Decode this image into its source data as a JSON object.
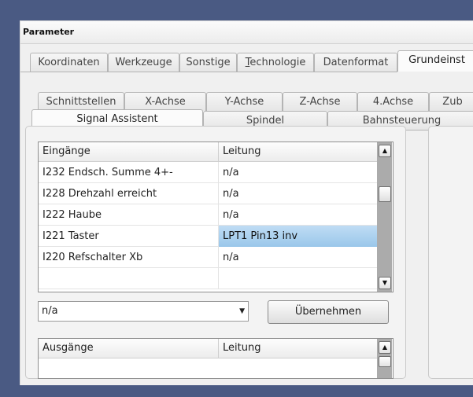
{
  "window": {
    "title": "Parameter"
  },
  "main_tabs": [
    {
      "label": "Koordinaten"
    },
    {
      "label": "Werkzeuge"
    },
    {
      "label": "Sonstige"
    },
    {
      "label": "Technologie"
    },
    {
      "label": "Datenformat"
    },
    {
      "label": "Grundeinst"
    }
  ],
  "sub_tabs_back": [
    {
      "label": "Schnittstellen"
    },
    {
      "label": "X-Achse"
    },
    {
      "label": "Y-Achse"
    },
    {
      "label": "Z-Achse"
    },
    {
      "label": "4.Achse"
    },
    {
      "label": "Zub"
    }
  ],
  "sub_tabs_front": [
    {
      "label": "Signal Assistent"
    },
    {
      "label": "Spindel"
    },
    {
      "label": "Bahnsteuerung"
    }
  ],
  "inputs_table": {
    "headers": [
      "Eingänge",
      "Leitung"
    ],
    "rows": [
      {
        "name": "I232 Endsch. Summe 4+-",
        "line": "n/a"
      },
      {
        "name": "I228 Drehzahl erreicht",
        "line": "n/a"
      },
      {
        "name": "I222 Haube",
        "line": "n/a"
      },
      {
        "name": "I221 Taster",
        "line": "LPT1 Pin13 inv"
      },
      {
        "name": "I220 Refschalter Xb",
        "line": "n/a"
      }
    ]
  },
  "signal_combo": {
    "value": "n/a"
  },
  "apply_button": {
    "label": "Übernehmen"
  },
  "outputs_table": {
    "headers": [
      "Ausgänge",
      "Leitung"
    ]
  }
}
